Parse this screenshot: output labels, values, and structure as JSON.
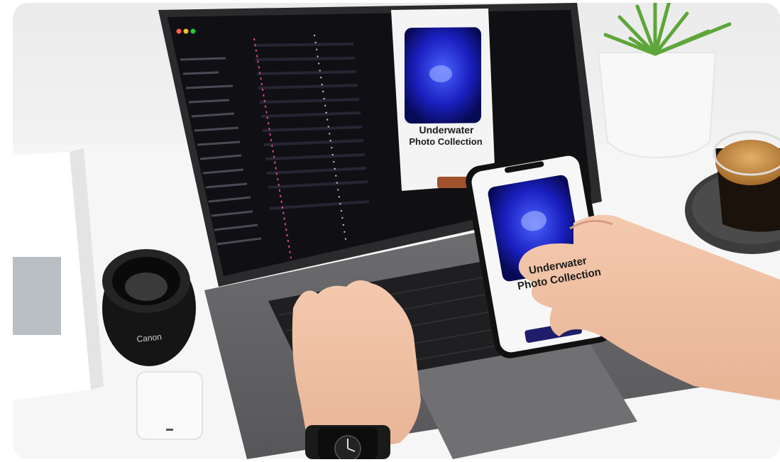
{
  "laptop": {
    "screen_card_title_line1": "Underwater",
    "screen_card_title_line2": "Photo Collection"
  },
  "phone": {
    "card_title_line1": "Underwater",
    "card_title_line2": "Photo Collection"
  }
}
